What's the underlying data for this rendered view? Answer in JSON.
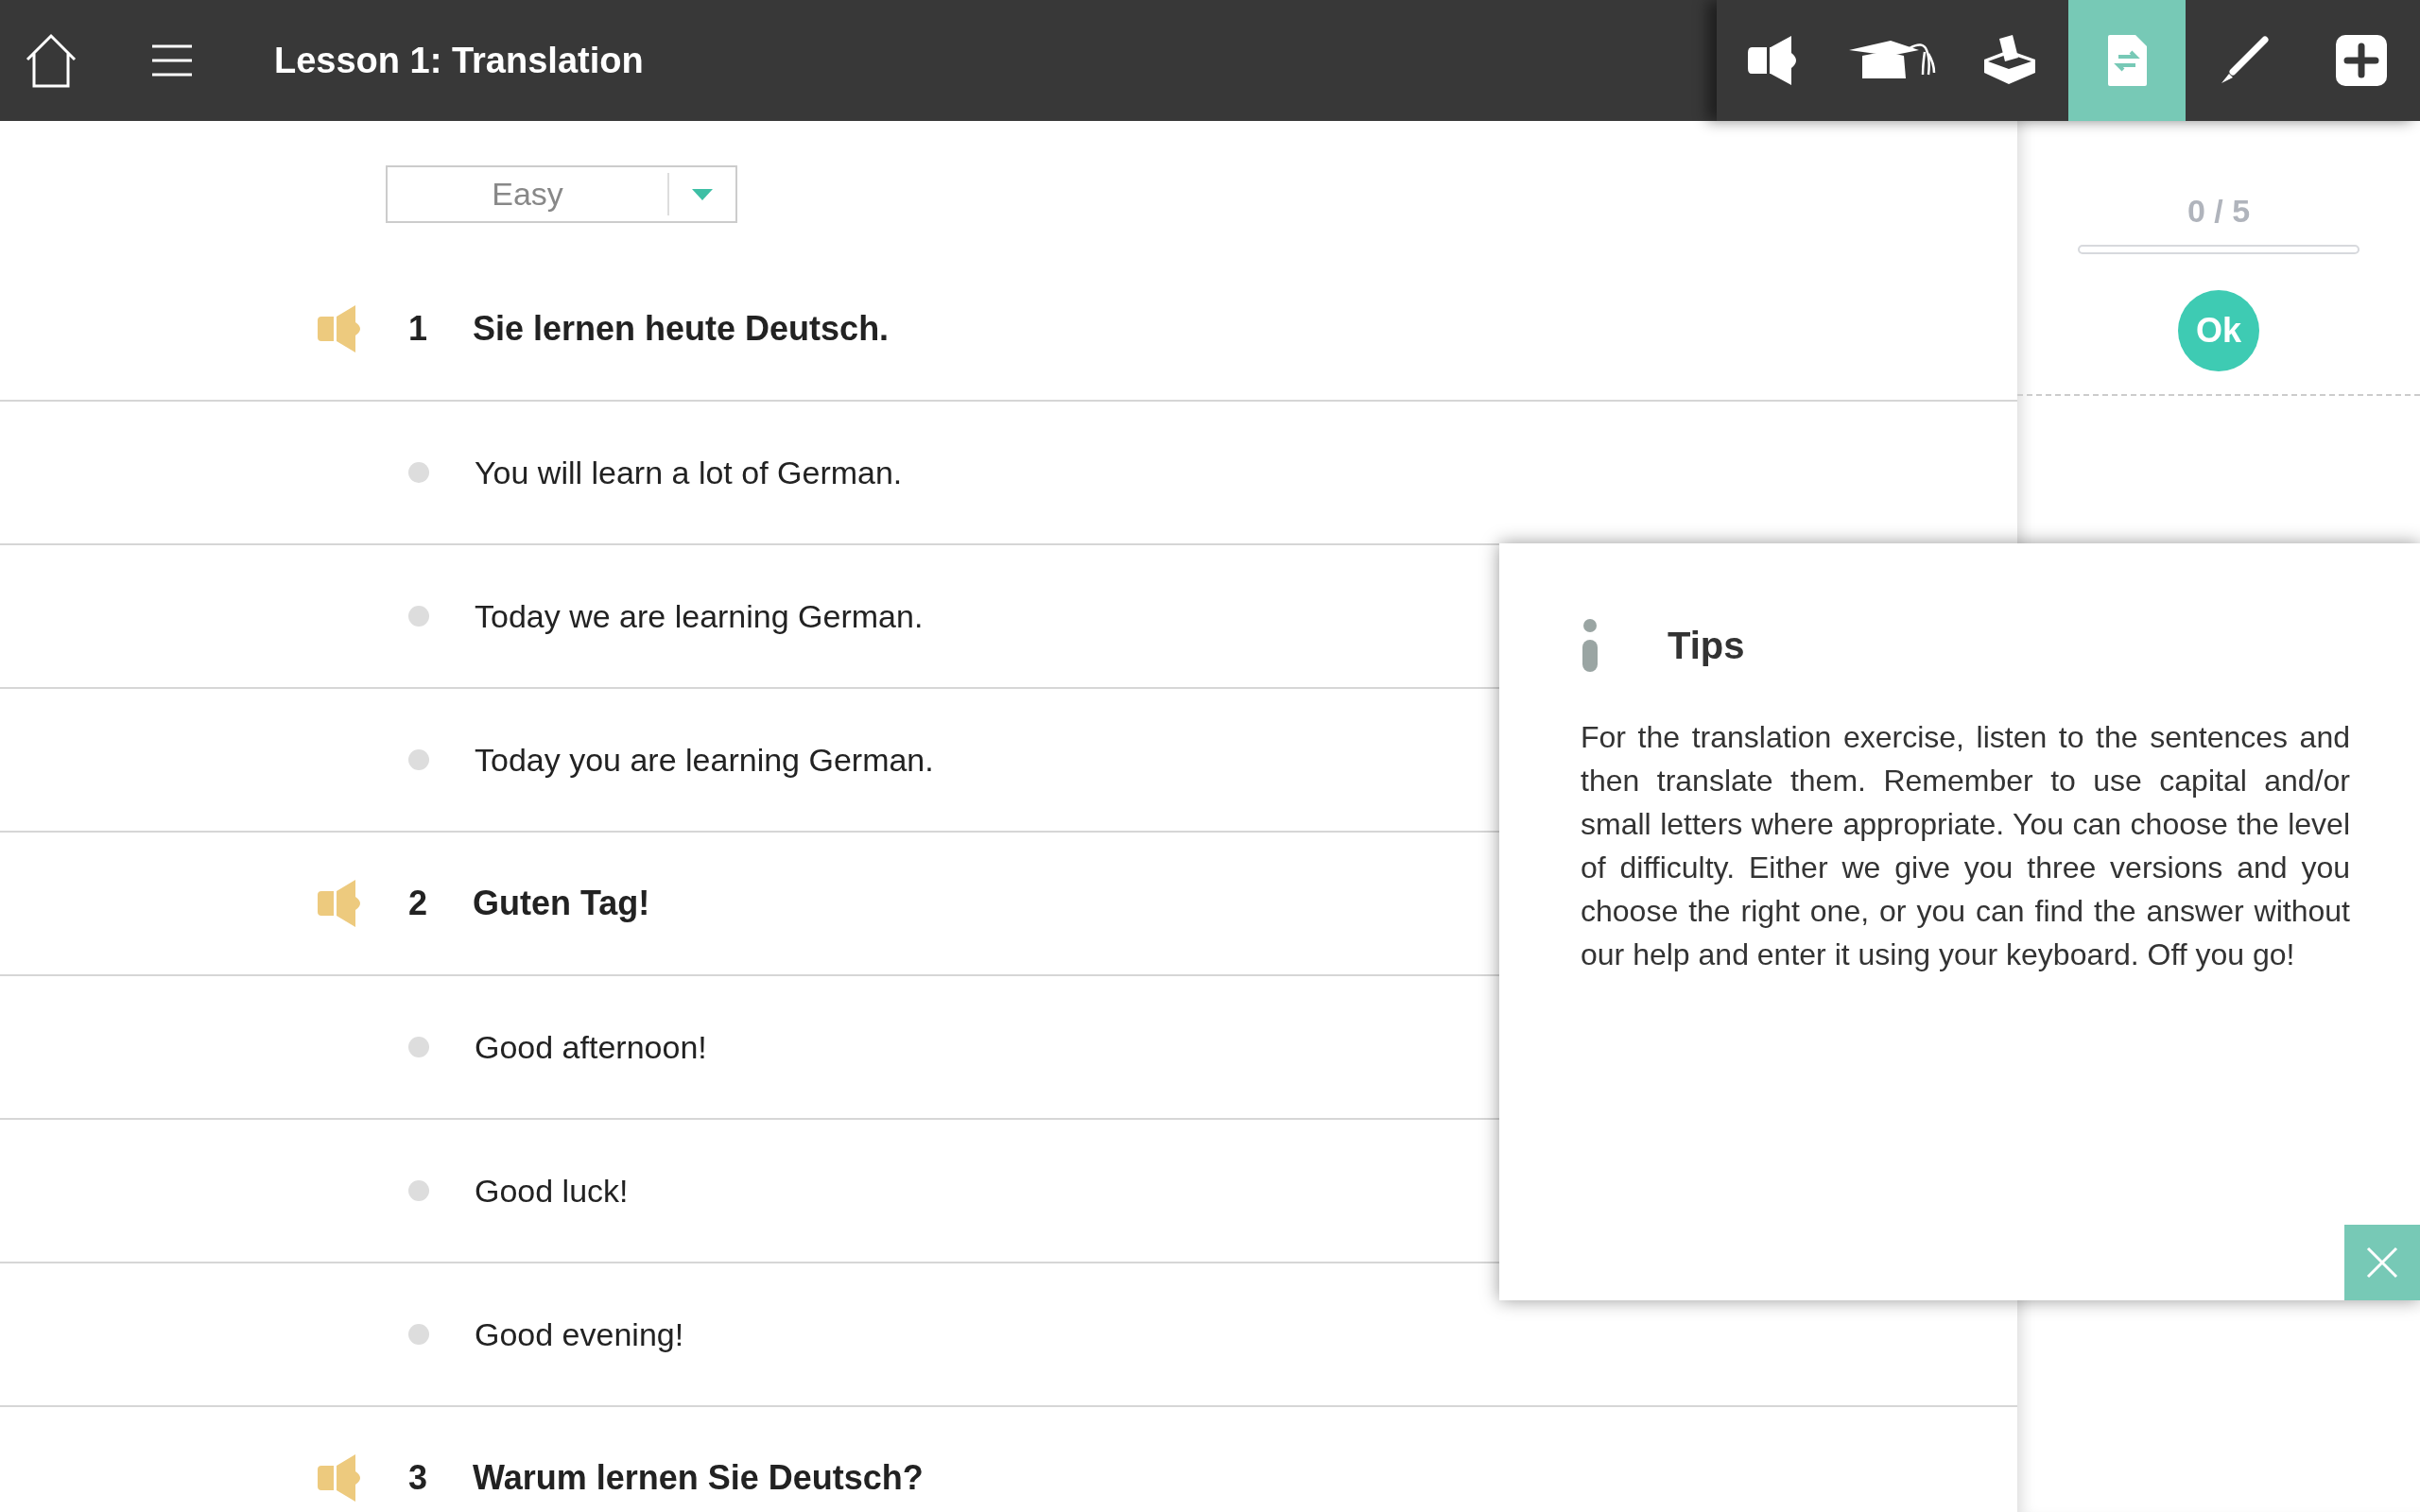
{
  "header": {
    "title": "Lesson 1: Translation"
  },
  "toolbar": [
    {
      "kind": "speaker",
      "selected": false
    },
    {
      "kind": "cap",
      "selected": false
    },
    {
      "kind": "box",
      "selected": false
    },
    {
      "kind": "doc",
      "selected": true
    },
    {
      "kind": "pen",
      "selected": false
    },
    {
      "kind": "plus",
      "selected": false
    }
  ],
  "difficulty": {
    "value": "Easy"
  },
  "rows": [
    {
      "kind": "sentence",
      "number": "1",
      "text": "Sie lernen heute Deutsch."
    },
    {
      "kind": "option",
      "text": "You will learn a lot of German.",
      "selected": false
    },
    {
      "kind": "option",
      "text": "Today we are learning German.",
      "selected": false
    },
    {
      "kind": "option",
      "text": "Today you are learning German.",
      "selected": false
    },
    {
      "kind": "sentence",
      "number": "2",
      "text": "Guten Tag!"
    },
    {
      "kind": "option",
      "text": "Good afternoon!",
      "selected": false
    },
    {
      "kind": "option",
      "text": "Good luck!",
      "selected": false
    },
    {
      "kind": "option",
      "text": "Good evening!",
      "selected": false
    },
    {
      "kind": "sentence",
      "number": "3",
      "text": "Warum lernen Sie Deutsch?"
    }
  ],
  "score": {
    "text": "0 / 5",
    "level": 0,
    "button": "Ok"
  },
  "tips": {
    "title": "Tips",
    "body": "For the translation exercise, listen to the sentences and then translate them. Remember to use capital and/or small letters where appropriate. You can choose the level of difficulty. Either we give you three versions and you choose the right one, or you can find the answer without our help and enter it using your keyboard. Off you go!"
  }
}
